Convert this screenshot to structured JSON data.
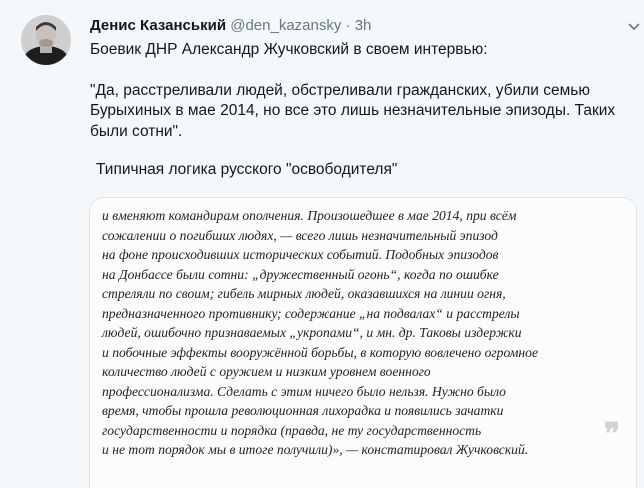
{
  "tweet": {
    "author_name": "Денис Казанський",
    "handle": "@den_kazansky",
    "separator": "·",
    "time": "3h",
    "paragraphs": [
      "Боевик ДНР Александр Жучковский в своем интервью:",
      "\"Да, расстреливали людей, обстреливали гражданских, убили семью Бурыхиных в мае 2014, но все это лишь незначительные эпизоды. Таких были сотни\".",
      "Типичная логика русского \"освободителя\""
    ]
  },
  "media": {
    "excerpt_lines": [
      "и вменяют командирам ополчения. Произошедшее в мае 2014, при всём",
      "сожалении о погибших людях, — всего лишь незначительный эпизод",
      "на фоне происходивших исторических событий. Подобных эпизодов",
      "на Донбассе были сотни: „дружественный огонь“, когда по ошибке",
      "стреляли по своим; гибель мирных людей, оказавшихся на линии огня,",
      "предназначенного противнику; содержание „на подвалах“ и расстрелы",
      "людей, ошибочно признаваемых „укропами“, и мн. др. Таковы издержки",
      "и побочные эффекты вооружённой борьбы, в которую вовлечено огромное",
      "количество людей с оружием и низким уровнем военного",
      "профессионализма. Сделать с этим ничего было нельзя. Нужно было",
      "время, чтобы прошла революционная лихорадка и появились зачатки",
      "государственности и порядка (правда, не ту государственность",
      "и не тот порядок мы в итоге получили)», — констатировал Жучковский."
    ],
    "quote_glyph": "❞"
  },
  "icons": {
    "menu": "chevron-down-icon",
    "avatar": "avatar"
  }
}
